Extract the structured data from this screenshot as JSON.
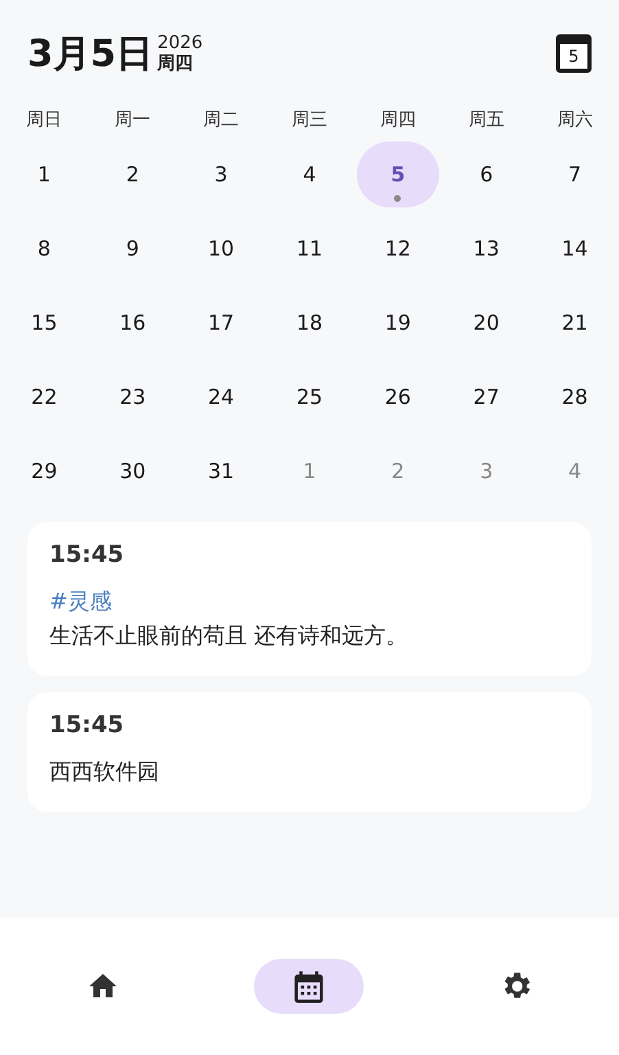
{
  "header": {
    "date": "3月5日",
    "year": "2026",
    "weekday": "周四",
    "today_badge": "5"
  },
  "weekdays": [
    "周日",
    "周一",
    "周二",
    "周三",
    "周四",
    "周五",
    "周六"
  ],
  "days": [
    {
      "label": "1",
      "selected": false,
      "other_month": false,
      "has_event": false
    },
    {
      "label": "2",
      "selected": false,
      "other_month": false,
      "has_event": false
    },
    {
      "label": "3",
      "selected": false,
      "other_month": false,
      "has_event": false
    },
    {
      "label": "4",
      "selected": false,
      "other_month": false,
      "has_event": false
    },
    {
      "label": "5",
      "selected": true,
      "other_month": false,
      "has_event": true
    },
    {
      "label": "6",
      "selected": false,
      "other_month": false,
      "has_event": false
    },
    {
      "label": "7",
      "selected": false,
      "other_month": false,
      "has_event": false
    },
    {
      "label": "8",
      "selected": false,
      "other_month": false,
      "has_event": false
    },
    {
      "label": "9",
      "selected": false,
      "other_month": false,
      "has_event": false
    },
    {
      "label": "10",
      "selected": false,
      "other_month": false,
      "has_event": false
    },
    {
      "label": "11",
      "selected": false,
      "other_month": false,
      "has_event": false
    },
    {
      "label": "12",
      "selected": false,
      "other_month": false,
      "has_event": false
    },
    {
      "label": "13",
      "selected": false,
      "other_month": false,
      "has_event": false
    },
    {
      "label": "14",
      "selected": false,
      "other_month": false,
      "has_event": false
    },
    {
      "label": "15",
      "selected": false,
      "other_month": false,
      "has_event": false
    },
    {
      "label": "16",
      "selected": false,
      "other_month": false,
      "has_event": false
    },
    {
      "label": "17",
      "selected": false,
      "other_month": false,
      "has_event": false
    },
    {
      "label": "18",
      "selected": false,
      "other_month": false,
      "has_event": false
    },
    {
      "label": "19",
      "selected": false,
      "other_month": false,
      "has_event": false
    },
    {
      "label": "20",
      "selected": false,
      "other_month": false,
      "has_event": false
    },
    {
      "label": "21",
      "selected": false,
      "other_month": false,
      "has_event": false
    },
    {
      "label": "22",
      "selected": false,
      "other_month": false,
      "has_event": false
    },
    {
      "label": "23",
      "selected": false,
      "other_month": false,
      "has_event": false
    },
    {
      "label": "24",
      "selected": false,
      "other_month": false,
      "has_event": false
    },
    {
      "label": "25",
      "selected": false,
      "other_month": false,
      "has_event": false
    },
    {
      "label": "26",
      "selected": false,
      "other_month": false,
      "has_event": false
    },
    {
      "label": "27",
      "selected": false,
      "other_month": false,
      "has_event": false
    },
    {
      "label": "28",
      "selected": false,
      "other_month": false,
      "has_event": false
    },
    {
      "label": "29",
      "selected": false,
      "other_month": false,
      "has_event": false
    },
    {
      "label": "30",
      "selected": false,
      "other_month": false,
      "has_event": false
    },
    {
      "label": "31",
      "selected": false,
      "other_month": false,
      "has_event": false
    },
    {
      "label": "1",
      "selected": false,
      "other_month": true,
      "has_event": false
    },
    {
      "label": "2",
      "selected": false,
      "other_month": true,
      "has_event": false
    },
    {
      "label": "3",
      "selected": false,
      "other_month": true,
      "has_event": false
    },
    {
      "label": "4",
      "selected": false,
      "other_month": true,
      "has_event": false
    }
  ],
  "notes": [
    {
      "time": "15:45",
      "tag": "#灵感",
      "text": "生活不止眼前的苟且 还有诗和远方。"
    },
    {
      "time": "15:45",
      "text": "西西软件园"
    }
  ],
  "nav": [
    {
      "kind": "home",
      "selected": false
    },
    {
      "kind": "calendar",
      "selected": true
    },
    {
      "kind": "settings",
      "selected": false
    }
  ]
}
